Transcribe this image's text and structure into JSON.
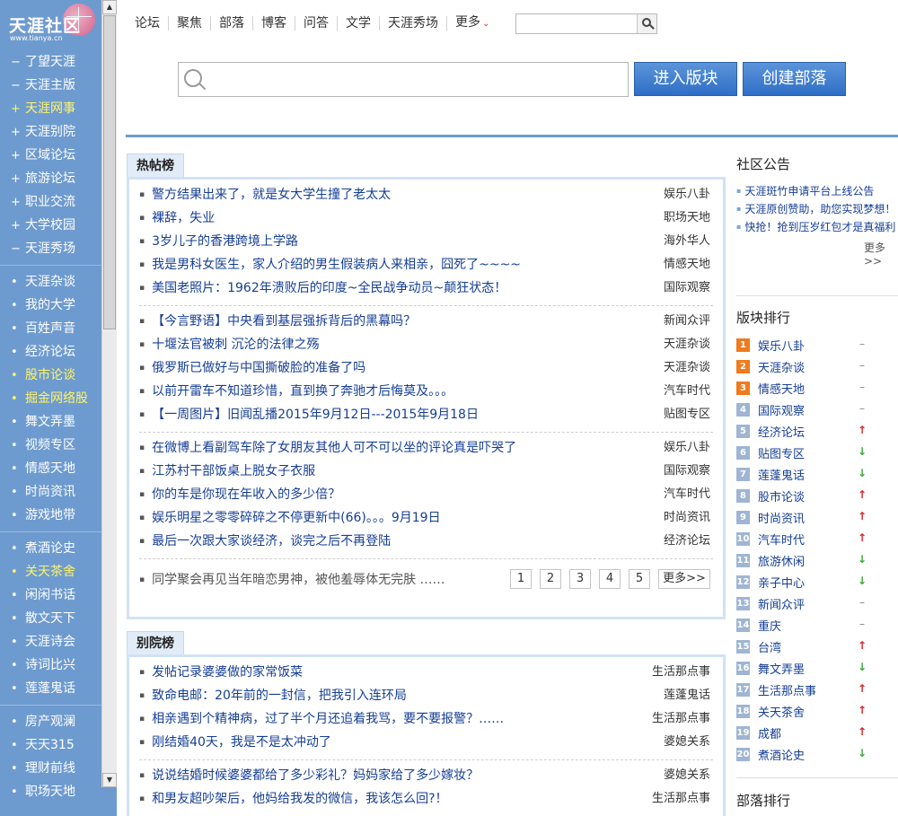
{
  "logo": {
    "text": "天涯社区",
    "url": "www.tianya.cn"
  },
  "sidebar": {
    "groups": [
      [
        {
          "mark": "−",
          "label": "了望天涯",
          "highlight": false
        },
        {
          "mark": "−",
          "label": "天涯主版",
          "highlight": false
        },
        {
          "mark": "+",
          "label": "天涯网事",
          "highlight": true
        },
        {
          "mark": "+",
          "label": "天涯别院",
          "highlight": false
        },
        {
          "mark": "+",
          "label": "区域论坛",
          "highlight": false
        },
        {
          "mark": "+",
          "label": "旅游论坛",
          "highlight": false
        },
        {
          "mark": "+",
          "label": "职业交流",
          "highlight": false
        },
        {
          "mark": "+",
          "label": "大学校园",
          "highlight": false
        },
        {
          "mark": "−",
          "label": "天涯秀场",
          "highlight": false
        }
      ],
      [
        {
          "mark": "•",
          "label": "天涯杂谈",
          "highlight": false
        },
        {
          "mark": "•",
          "label": "我的大学",
          "highlight": false
        },
        {
          "mark": "•",
          "label": "百姓声音",
          "highlight": false
        },
        {
          "mark": "•",
          "label": "经济论坛",
          "highlight": false
        },
        {
          "mark": "•",
          "label": "股市论谈",
          "highlight": true
        },
        {
          "mark": "•",
          "label": "掘金网络股",
          "highlight": true
        },
        {
          "mark": "•",
          "label": "舞文弄墨",
          "highlight": false
        },
        {
          "mark": "•",
          "label": "视频专区",
          "highlight": false
        },
        {
          "mark": "•",
          "label": "情感天地",
          "highlight": false
        },
        {
          "mark": "•",
          "label": "时尚资讯",
          "highlight": false
        },
        {
          "mark": "•",
          "label": "游戏地带",
          "highlight": false
        }
      ],
      [
        {
          "mark": "•",
          "label": "煮酒论史",
          "highlight": false
        },
        {
          "mark": "•",
          "label": "关天茶舍",
          "highlight": true
        },
        {
          "mark": "•",
          "label": "闲闲书话",
          "highlight": false
        },
        {
          "mark": "•",
          "label": "散文天下",
          "highlight": false
        },
        {
          "mark": "•",
          "label": "天涯诗会",
          "highlight": false
        },
        {
          "mark": "•",
          "label": "诗词比兴",
          "highlight": false
        },
        {
          "mark": "•",
          "label": "莲蓬鬼话",
          "highlight": false
        }
      ],
      [
        {
          "mark": "•",
          "label": "房产观澜",
          "highlight": false
        },
        {
          "mark": "•",
          "label": "天天315",
          "highlight": false
        },
        {
          "mark": "•",
          "label": "理财前线",
          "highlight": false
        },
        {
          "mark": "•",
          "label": "职场天地",
          "highlight": false
        }
      ]
    ]
  },
  "topnav": {
    "items": [
      "论坛",
      "聚焦",
      "部落",
      "博客",
      "问答",
      "文学",
      "天涯秀场"
    ],
    "more_label": "更多"
  },
  "search": {
    "enter_label": "进入版块",
    "create_label": "创建部落"
  },
  "hot": {
    "tab_label": "热帖榜",
    "groups": [
      [
        {
          "title": "警方结果出来了，就是女大学生撞了老太太",
          "cat": "娱乐八卦"
        },
        {
          "title": "裸辞，失业",
          "cat": "职场天地"
        },
        {
          "title": "3岁儿子的香港跨境上学路",
          "cat": "海外华人"
        },
        {
          "title": "我是男科女医生，家人介绍的男生假装病人来相亲，囧死了~~~~",
          "cat": "情感天地"
        },
        {
          "title": "美国老照片：1962年溃败后的印度~全民战争动员~颠狂状态！",
          "cat": "国际观察"
        }
      ],
      [
        {
          "title": "【今言野语】中央看到基层强拆背后的黑幕吗？",
          "cat": "新闻众评"
        },
        {
          "title": "十堰法官被刺  沉沦的法律之殇",
          "cat": "天涯杂谈"
        },
        {
          "title": "俄罗斯已做好与中国撕破脸的准备了吗",
          "cat": "天涯杂谈"
        },
        {
          "title": "以前开雷车不知道珍惜，直到换了奔驰才后悔莫及。。。",
          "cat": "汽车时代"
        },
        {
          "title": "【一周图片】旧闻乱播2015年9月12日---2015年9月18日",
          "cat": "贴图专区"
        }
      ],
      [
        {
          "title": "在微博上看副驾车除了女朋友其他人可不可以坐的评论真是吓哭了",
          "cat": "娱乐八卦"
        },
        {
          "title": "江苏村干部饭桌上脱女子衣服",
          "cat": "国际观察"
        },
        {
          "title": "你的车是你现在年收入的多少倍？",
          "cat": "汽车时代"
        },
        {
          "title": "娱乐明星之零零碎碎之不停更新中(66)。。。9月19日",
          "cat": "时尚资讯"
        },
        {
          "title": "最后一次跟大家谈经济，谈完之后不再登陆",
          "cat": "经济论坛"
        }
      ]
    ],
    "footer_text": "同学聚会再见当年暗恋男神，被他羞辱体无完肤 ……",
    "pages": [
      "1",
      "2",
      "3",
      "4",
      "5"
    ],
    "more_label": "更多>>"
  },
  "bieyuan": {
    "tab_label": "别院榜",
    "groups": [
      [
        {
          "title": "发帖记录婆婆做的家常饭菜",
          "cat": "生活那点事"
        },
        {
          "title": "致命电邮：20年前的一封信，把我引入连环局",
          "cat": "莲蓬鬼话"
        },
        {
          "title": "相亲遇到个精神病，过了半个月还追着我骂，要不要报警？……",
          "cat": "生活那点事"
        },
        {
          "title": "刚结婚40天，我是不是太冲动了",
          "cat": "婆媳关系"
        }
      ],
      [
        {
          "title": "说说结婚时候婆婆都给了多少彩礼？妈妈家给了多少嫁妆？",
          "cat": "婆媳关系"
        },
        {
          "title": "和男友超吵架后，他妈给我发的微信，我该怎么回?！",
          "cat": "生活那点事"
        }
      ]
    ]
  },
  "notice": {
    "title": "社区公告",
    "items": [
      "天涯斑竹申请平台上线公告",
      "天涯原创赞助，助您实现梦想！",
      "快抢！抢到压岁红包才是真福利"
    ],
    "more_label": "更多>>"
  },
  "ranking": {
    "title": "版块排行",
    "items": [
      {
        "rank": "1",
        "name": "娱乐八卦",
        "trend": "flat"
      },
      {
        "rank": "2",
        "name": "天涯杂谈",
        "trend": "flat"
      },
      {
        "rank": "3",
        "name": "情感天地",
        "trend": "flat"
      },
      {
        "rank": "4",
        "name": "国际观察",
        "trend": "flat"
      },
      {
        "rank": "5",
        "name": "经济论坛",
        "trend": "up"
      },
      {
        "rank": "6",
        "name": "贴图专区",
        "trend": "down"
      },
      {
        "rank": "7",
        "name": "莲蓬鬼话",
        "trend": "down"
      },
      {
        "rank": "8",
        "name": "股市论谈",
        "trend": "up"
      },
      {
        "rank": "9",
        "name": "时尚资讯",
        "trend": "up"
      },
      {
        "rank": "10",
        "name": "汽车时代",
        "trend": "up"
      },
      {
        "rank": "11",
        "name": "旅游休闲",
        "trend": "down"
      },
      {
        "rank": "12",
        "name": "亲子中心",
        "trend": "down"
      },
      {
        "rank": "13",
        "name": "新闻众评",
        "trend": "flat"
      },
      {
        "rank": "14",
        "name": "重庆",
        "trend": "flat"
      },
      {
        "rank": "15",
        "name": "台湾",
        "trend": "up"
      },
      {
        "rank": "16",
        "name": "舞文弄墨",
        "trend": "down"
      },
      {
        "rank": "17",
        "name": "生活那点事",
        "trend": "up"
      },
      {
        "rank": "18",
        "name": "关天茶舍",
        "trend": "up"
      },
      {
        "rank": "19",
        "name": "成都",
        "trend": "up"
      },
      {
        "rank": "20",
        "name": "煮酒论史",
        "trend": "down"
      }
    ]
  },
  "tribe_ranking": {
    "title": "部落排行"
  },
  "colors": {
    "sidebar_bg": "#6e9bcf",
    "highlight_text": "#fff46a",
    "link_blue": "#153e96",
    "rank_top": "#f07b1e",
    "trend_up": "#e02222",
    "trend_down": "#3aaa35"
  }
}
